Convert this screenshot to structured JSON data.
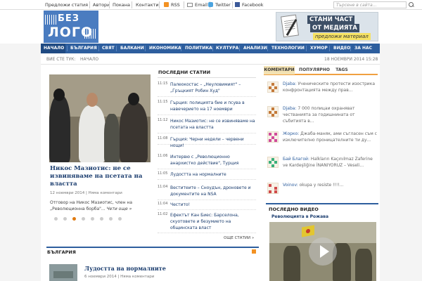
{
  "topbar": {
    "links": [
      "Предложи статия",
      "Автори",
      "Покана",
      "Контакти"
    ],
    "rss": "RSS",
    "email": "Email",
    "twitter": "Twitter",
    "facebook": "Facebook",
    "search_placeholder": "Търсене в сайта..."
  },
  "header": {
    "logo_top": "БЕЗ",
    "logo_bottom": "ЛОГО",
    "ad_line1": "СТАНИ ЧАСТ",
    "ad_line2": "ОТ МЕДИЯТА",
    "ad_line3": "предложи материал"
  },
  "nav": {
    "items": [
      "НАЧАЛО",
      "БЪЛГАРИЯ",
      "СВЯТ",
      "БАЛКАНИ",
      "ИКОНОМИКА",
      "ПОЛИТИКА",
      "КУЛТУРА",
      "АНАЛИЗИ",
      "ТЕХНОЛОГИИ",
      "ХУМОР",
      "ВИДЕО",
      "ЗА НАС"
    ]
  },
  "breadcrumb": {
    "prefix": "ВИЕ СТЕ ТУК:",
    "current": "НАЧАЛО",
    "datetime": "18 НОЕМВРИ 2014  15:28"
  },
  "slider": {
    "title": "Никос Мазиотис: не се извиняваме на псетата на властта",
    "date": "12 ноември 2014",
    "comments": "Няма коментари",
    "excerpt": "Отговор на Никос Мазиотис, член на „Революционна борба\"...",
    "read_more": "Чети още »",
    "dots_total": 8,
    "dots_active": 3
  },
  "recent": {
    "heading": "ПОСЛЕДНИ СТАТИИ",
    "items": [
      {
        "time": "11:15",
        "title": "Палеокостас – „Неуловимият\" – „Гръцкият Робин Худ\""
      },
      {
        "time": "11:15",
        "title": "Гърция: полицията бие и псува в навечерието на 17 ноември"
      },
      {
        "time": "11:12",
        "title": "Никос Мазиотис: не се извиняваме на псетата на властта"
      },
      {
        "time": "11:08",
        "title": "Гърция: Черни недели – червени нощи!"
      },
      {
        "time": "11:06",
        "title": "Интервю с „Революционно анархистко действие\", Турция"
      },
      {
        "time": "11:05",
        "title": "Лудостта на нормалните"
      },
      {
        "time": "11:04",
        "title": "Веститеите – Сноудън, дроновете и документите на NSA"
      },
      {
        "time": "11:04",
        "title": "Честито!"
      },
      {
        "time": "11:02",
        "title": "Ефектът Кан Биес: Барселона, скуотовете и безумието на общинската власт"
      }
    ],
    "more": "ОЩЕ СТАТИИ »"
  },
  "bulgaria": {
    "heading": "БЪЛГАРИЯ",
    "article_title": "Лудостта на нормалните",
    "article_date": "6 ноември 2014",
    "article_comments": "Няма коментари"
  },
  "sidebar": {
    "tabs": [
      "КОМЕНТАРИ",
      "ПОПУЛЯРНО",
      "TAGS"
    ],
    "comments": [
      {
        "author": "Djaba:",
        "text": " Ученическите протести изострика конфронтацията между прав..."
      },
      {
        "author": "Djaba:",
        "text": " 7 000 полицаи охраняват честванията за годишнината от събитията в..."
      },
      {
        "author": "Жорко:",
        "text": " Джаба-маняк, ами съгласен съм с изключително проницателните ти ду..."
      },
      {
        "author": "Бай Благой:",
        "text": " Halkların Kaçınılmaz Zaferine ve Kardeşliğine İNANIYORUZ – Veseli..."
      },
      {
        "author": "Voinov:",
        "text": " okupa y resiste !!!!..."
      }
    ],
    "video_heading": "ПОСЛЕДНО ВИДЕО",
    "video_title": "Революцията в Рожава"
  },
  "colors": {
    "nav_bg": "#2d5e9e",
    "logo_bg": "#4a7cc0",
    "link": "#1a3c6e",
    "accent": "#f0a040"
  }
}
